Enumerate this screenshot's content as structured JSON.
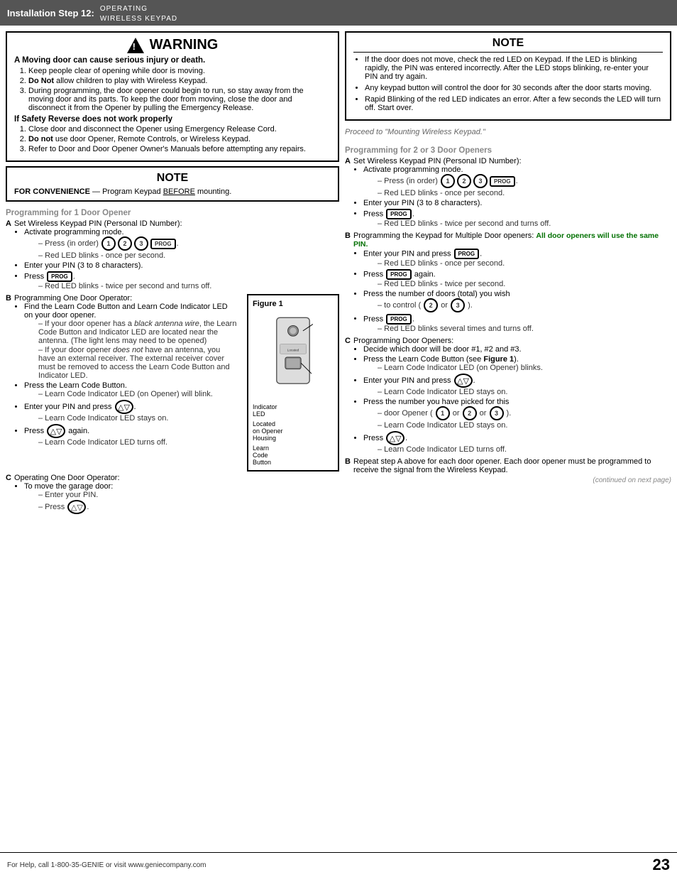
{
  "header": {
    "step_label": "Installation Step 12:",
    "subtitle_line1": "Operating",
    "subtitle_line2": "Wireless Keypad"
  },
  "warning": {
    "title": "WARNING",
    "bold_line": "A Moving door can cause serious injury or death.",
    "items": [
      "Keep people clear of opening while door is moving.",
      "Do Not allow children to play with Wireless Keypad.",
      "During programming, the door opener could begin to run, so stay away from the moving door and its parts. To keep the door from moving, close the door and disconnect it from the Opener by pulling the Emergency Release."
    ],
    "safety_header": "If Safety Reverse does not work properly",
    "safety_items": [
      "Close door and disconnect the Opener using Emergency Release Cord.",
      "Do not use door Opener, Remote Controls, or Wireless Keypad.",
      "Refer to Door and Door Opener Owner's Manuals before attempting any repairs."
    ]
  },
  "note_convenience": {
    "title": "NOTE",
    "content": "FOR CONVENIENCE — Program Keypad BEFORE mounting."
  },
  "right_note": {
    "title": "NOTE",
    "items": [
      "If the door does not move, check the red LED on Keypad. If the LED is blinking rapidly, the PIN was entered incorrectly. After the LED stops blinking, re-enter your PIN and try again.",
      "Any keypad button will control the door for 30 seconds after the door starts moving.",
      "Rapid Blinking of the red LED indicates an error. After a few seconds the LED will turn off. Start over."
    ]
  },
  "proceed_text": "Proceed to \"Mounting Wireless Keypad.\"",
  "prog_1door": {
    "heading": "Programming for 1 Door Opener",
    "step_a_label": "A",
    "step_a_text": "Set Wireless Keypad PIN (Personal ID Number):",
    "activate": "Activate programming mode.",
    "press_order": "Press (in order)",
    "red_led_once": "Red LED blinks - once per second.",
    "enter_pin": "Enter your PIN (3 to 8 characters).",
    "press_prog": "Press",
    "red_led_twice": "Red LED blinks - twice per second and turns off.",
    "step_b_label": "B",
    "step_b_text": "Programming One Door Operator:",
    "figure_title": "Figure 1",
    "figure_indicator": "Indicator LED",
    "figure_located": "Located on Opener Housing",
    "figure_learn": "Learn Code Button",
    "b_items": [
      "Find the Learn Code Button and Learn Code Indicator LED on your door opener.",
      "Press the Learn Code Button.",
      "Enter your PIN and press",
      "Press"
    ],
    "b_dash_items": [
      "If your door opener has a black antenna wire, the Learn Code Button and Indicator LED are located near the antenna. (The light lens may need to be opened)",
      "If your door opener does not have an antenna, you have an external receiver. The external receiver cover must be removed to access the Learn Code Button and Indicator LED.",
      "Learn Code Indicator LED (on Opener) will blink.",
      "Learn Code Indicator LED stays on.",
      "Learn Code Indicator LED turns off."
    ],
    "step_c_label": "C",
    "step_c_text": "Operating One Door Operator:",
    "c_items": [
      "To move the garage door:",
      "Enter your PIN.",
      "Press"
    ]
  },
  "prog_2door": {
    "heading": "Programming for 2 or 3 Door Openers",
    "step_a_label": "A",
    "step_a_text": "Set Wireless Keypad PIN (Personal ID Number):",
    "activate": "Activate programming mode.",
    "press_order": "Press (in order)",
    "red_led_once": "Red LED blinks - once per second.",
    "enter_pin": "Enter your PIN (3 to 8 characters).",
    "press_prog": "Press",
    "red_led_twice": "Red LED blinks - twice per second and turns off.",
    "step_b_label": "B",
    "step_b_text": "Programming the Keypad for Multiple Door openers:",
    "step_b_note": "All door openers will use the same PIN.",
    "b2_items": [
      "Enter your PIN and press",
      "Press",
      "Press the number of doors (total) you wish",
      "Press"
    ],
    "b2_dash_items": [
      "Red LED blinks - once per second.",
      "again.",
      "Red LED blinks - twice per second.",
      "to control (",
      "Red LED blinks several times and turns off."
    ],
    "step_c_label": "C",
    "step_c_text": "Programming Door Openers:",
    "c2_items": [
      "Decide which door will be door #1, #2 and #3.",
      "Press the Learn Code Button (see Figure 1).",
      "Enter your PIN and press",
      "Press the number you have picked for this",
      "Press"
    ],
    "c2_dash_items": [
      "Learn Code Indicator LED (on Opener) blinks.",
      "Learn Code Indicator LED stays on.",
      "door Opener (",
      "Learn Code Indicator LED stays on.",
      "Learn Code Indicator LED turns off."
    ],
    "step_b2_label": "B",
    "step_b2_text": "Repeat step A above for each door opener. Each door opener must be programmed to receive the signal from the Wireless Keypad.",
    "continued": "(continued on next page)"
  },
  "footer": {
    "help_text": "For Help, call 1-800-35-GENIE or visit www.geniecompany.com",
    "page_number": "23"
  }
}
